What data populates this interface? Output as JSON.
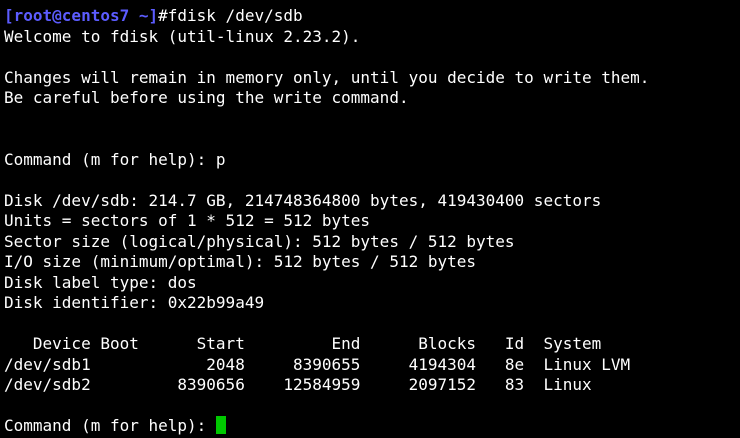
{
  "colors": {
    "background": "#000000",
    "text": "#ffffff",
    "prompt_host": "#5c5cff",
    "cursor": "#00c800"
  },
  "prompt": {
    "host": "[root@centos7 ~]",
    "command": "#fdisk /dev/sdb"
  },
  "welcome": "Welcome to fdisk (util-linux 2.23.2).",
  "warnings": [
    "Changes will remain in memory only, until you decide to write them.",
    "Be careful before using the write command."
  ],
  "command_prompt_1": "Command (m for help): p",
  "disk_info": [
    "Disk /dev/sdb: 214.7 GB, 214748364800 bytes, 419430400 sectors",
    "Units = sectors of 1 * 512 = 512 bytes",
    "Sector size (logical/physical): 512 bytes / 512 bytes",
    "I/O size (minimum/optimal): 512 bytes / 512 bytes",
    "Disk label type: dos",
    "Disk identifier: 0x22b99a49"
  ],
  "partition_table": {
    "header": "   Device Boot      Start         End      Blocks   Id  System",
    "columns": [
      "Device",
      "Boot",
      "Start",
      "End",
      "Blocks",
      "Id",
      "System"
    ],
    "rows_text": [
      "/dev/sdb1            2048     8390655     4194304   8e  Linux LVM",
      "/dev/sdb2         8390656    12584959     2097152   83  Linux"
    ],
    "rows": [
      {
        "device": "/dev/sdb1",
        "boot": "",
        "start": "2048",
        "end": "8390655",
        "blocks": "4194304",
        "id": "8e",
        "system": "Linux LVM"
      },
      {
        "device": "/dev/sdb2",
        "boot": "",
        "start": "8390656",
        "end": "12584959",
        "blocks": "2097152",
        "id": "83",
        "system": "Linux"
      }
    ]
  },
  "command_prompt_2": "Command (m for help): "
}
